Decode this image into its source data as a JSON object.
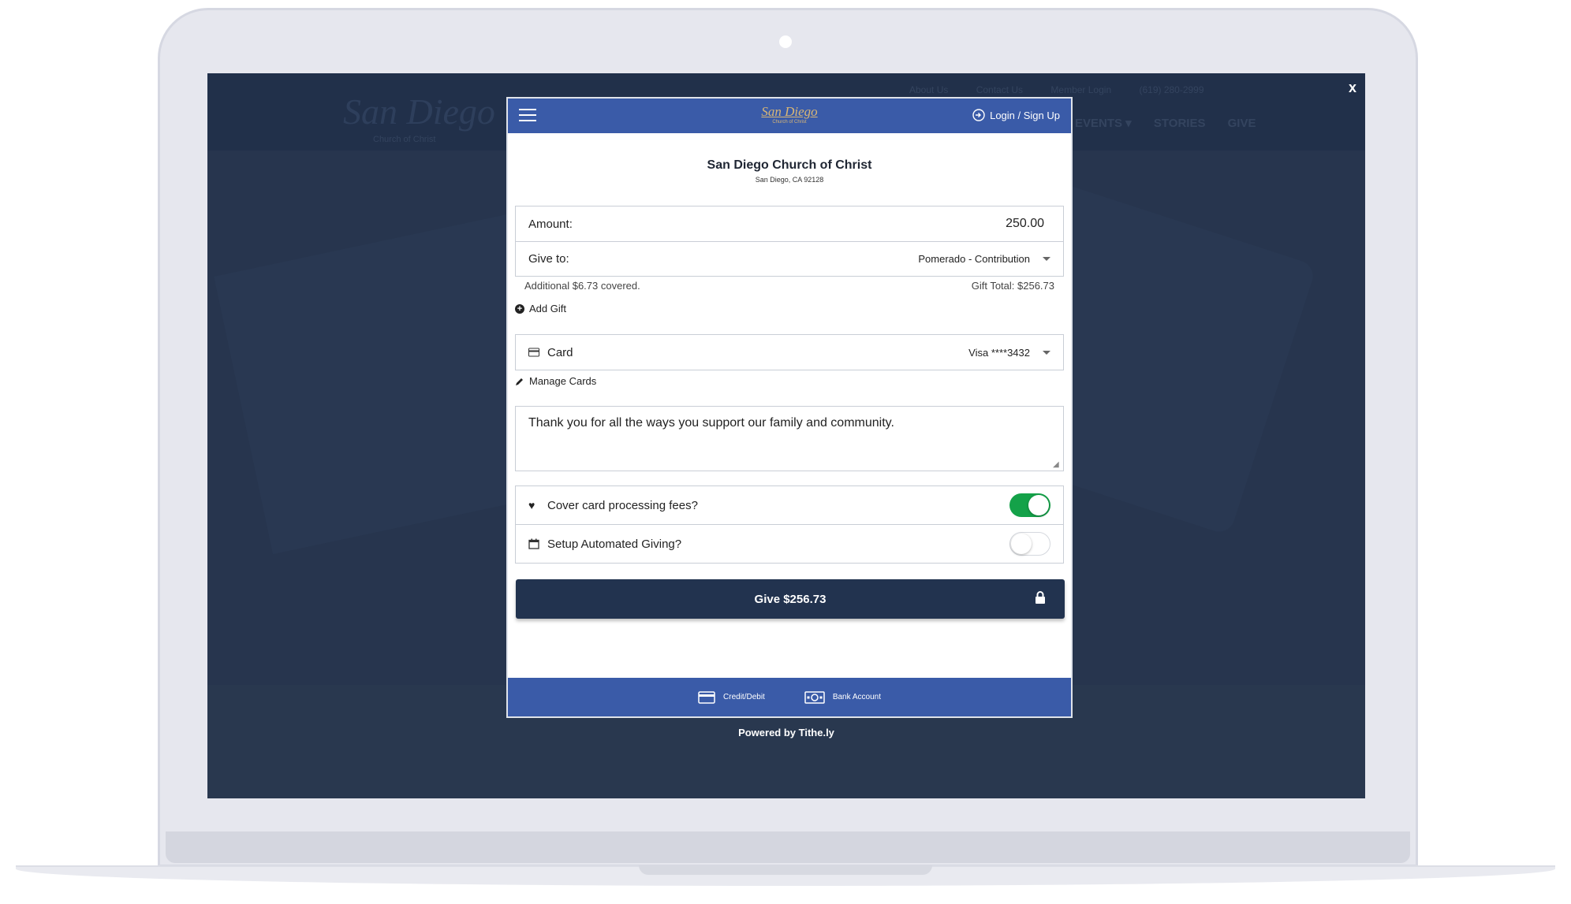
{
  "close_label": "x",
  "site": {
    "logo_text": "San Diego",
    "logo_sub": "Church of Christ",
    "top_links": [
      "About Us",
      "Contact Us",
      "Member Login",
      "(619) 280-2999"
    ],
    "nav": [
      "EVENTS ▾",
      "STORIES",
      "GIVE"
    ]
  },
  "modal": {
    "login_label": "Login / Sign Up",
    "logo_big": "San Diego",
    "logo_small": "Church of Christ",
    "church_name": "San Diego Church of Christ",
    "church_city": "San Diego, CA 92128",
    "amount_label": "Amount:",
    "amount_value": "250.00",
    "give_to_label": "Give to:",
    "give_to_value": "Pomerado - Contribution",
    "covered_note": "Additional $6.73 covered.",
    "gift_total": "Gift Total: $256.73",
    "add_gift": "Add Gift",
    "card_label": "Card",
    "card_value": "Visa ****3432",
    "manage_cards": "Manage Cards",
    "memo": "Thank you for all the ways you support our family and community.",
    "cover_fees_label": "Cover card processing fees?",
    "cover_fees_on": true,
    "automated_label": "Setup Automated Giving?",
    "automated_on": false,
    "give_button": "Give $256.73",
    "footer_tabs": [
      "Credit/Debit",
      "Bank Account"
    ]
  },
  "powered_by": "Powered by Tithe.ly",
  "colors": {
    "header_blue": "#3a5ba8",
    "navy": "#22334f",
    "toggle_green": "#14a249"
  }
}
